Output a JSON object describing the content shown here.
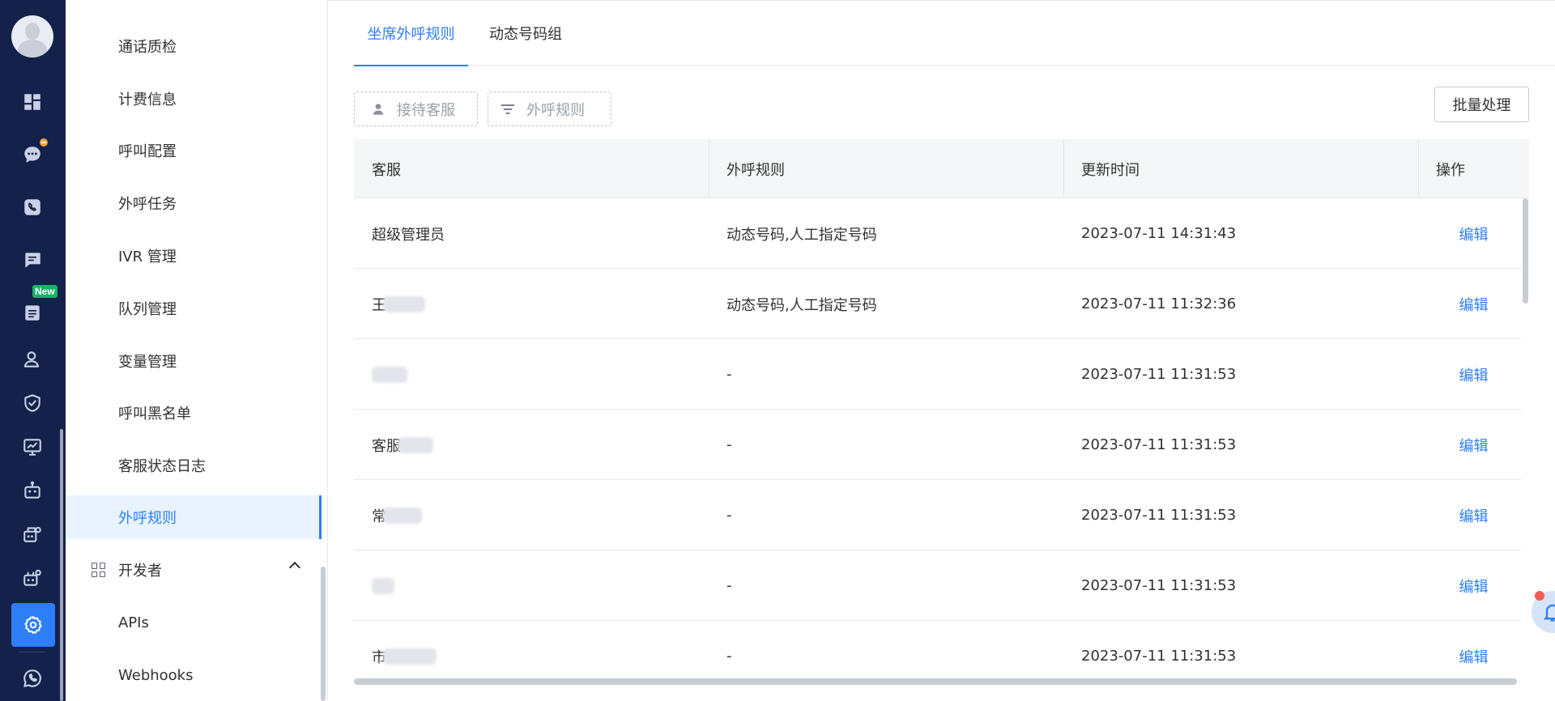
{
  "rail": {
    "icons": [
      "avatar",
      "dashboard-icon",
      "chat-icon",
      "phone-icon",
      "message-icon",
      "ticket-icon",
      "contacts-icon",
      "shield-icon",
      "monitor-icon",
      "robot-icon",
      "workflow-icon",
      "bot-group-icon",
      "settings-icon",
      "whatsapp-icon"
    ],
    "new_badge": "New",
    "active": "settings-icon"
  },
  "menu": {
    "items": [
      {
        "label": "通话质检"
      },
      {
        "label": "计费信息"
      },
      {
        "label": "呼叫配置"
      },
      {
        "label": "外呼任务"
      },
      {
        "label": "IVR 管理"
      },
      {
        "label": "队列管理"
      },
      {
        "label": "变量管理"
      },
      {
        "label": "呼叫黑名单"
      },
      {
        "label": "客服状态日志"
      },
      {
        "label": "外呼规则"
      }
    ],
    "active_item": "外呼规则",
    "group": {
      "label": "开发者",
      "expanded": true
    },
    "sub_items": [
      {
        "label": "APIs"
      },
      {
        "label": "Webhooks"
      }
    ]
  },
  "tabs": [
    {
      "label": "坐席外呼规则"
    },
    {
      "label": "动态号码组"
    }
  ],
  "filters": {
    "agent": "接待客服",
    "rule": "外呼规则"
  },
  "batch_button": "批量处理",
  "table": {
    "headers": [
      "客服",
      "外呼规则",
      "更新时间",
      "操作"
    ],
    "rows": [
      {
        "agent": "超级管理员",
        "rule": "动态号码,人工指定号码",
        "time": "2023-07-11 14:31:43",
        "action": "编辑"
      },
      {
        "agent": "王",
        "rule": "动态号码,人工指定号码",
        "time": "2023-07-11 11:32:36",
        "action": "编辑"
      },
      {
        "agent": "",
        "rule": "-",
        "time": "2023-07-11 11:31:53",
        "action": "编辑"
      },
      {
        "agent": "客服",
        "rule": "-",
        "time": "2023-07-11 11:31:53",
        "action": "编辑"
      },
      {
        "agent": "常",
        "rule": "-",
        "time": "2023-07-11 11:31:53",
        "action": "编辑"
      },
      {
        "agent": "",
        "rule": "-",
        "time": "2023-07-11 11:31:53",
        "action": "编辑"
      },
      {
        "agent": "市",
        "rule": "-",
        "time": "2023-07-11 11:31:53",
        "action": "编辑"
      }
    ]
  },
  "colors": {
    "accent": "#2d7ef7",
    "rail_bg": "#14214a",
    "new_badge": "#17b26a",
    "notify_badge": "#f4a533"
  }
}
